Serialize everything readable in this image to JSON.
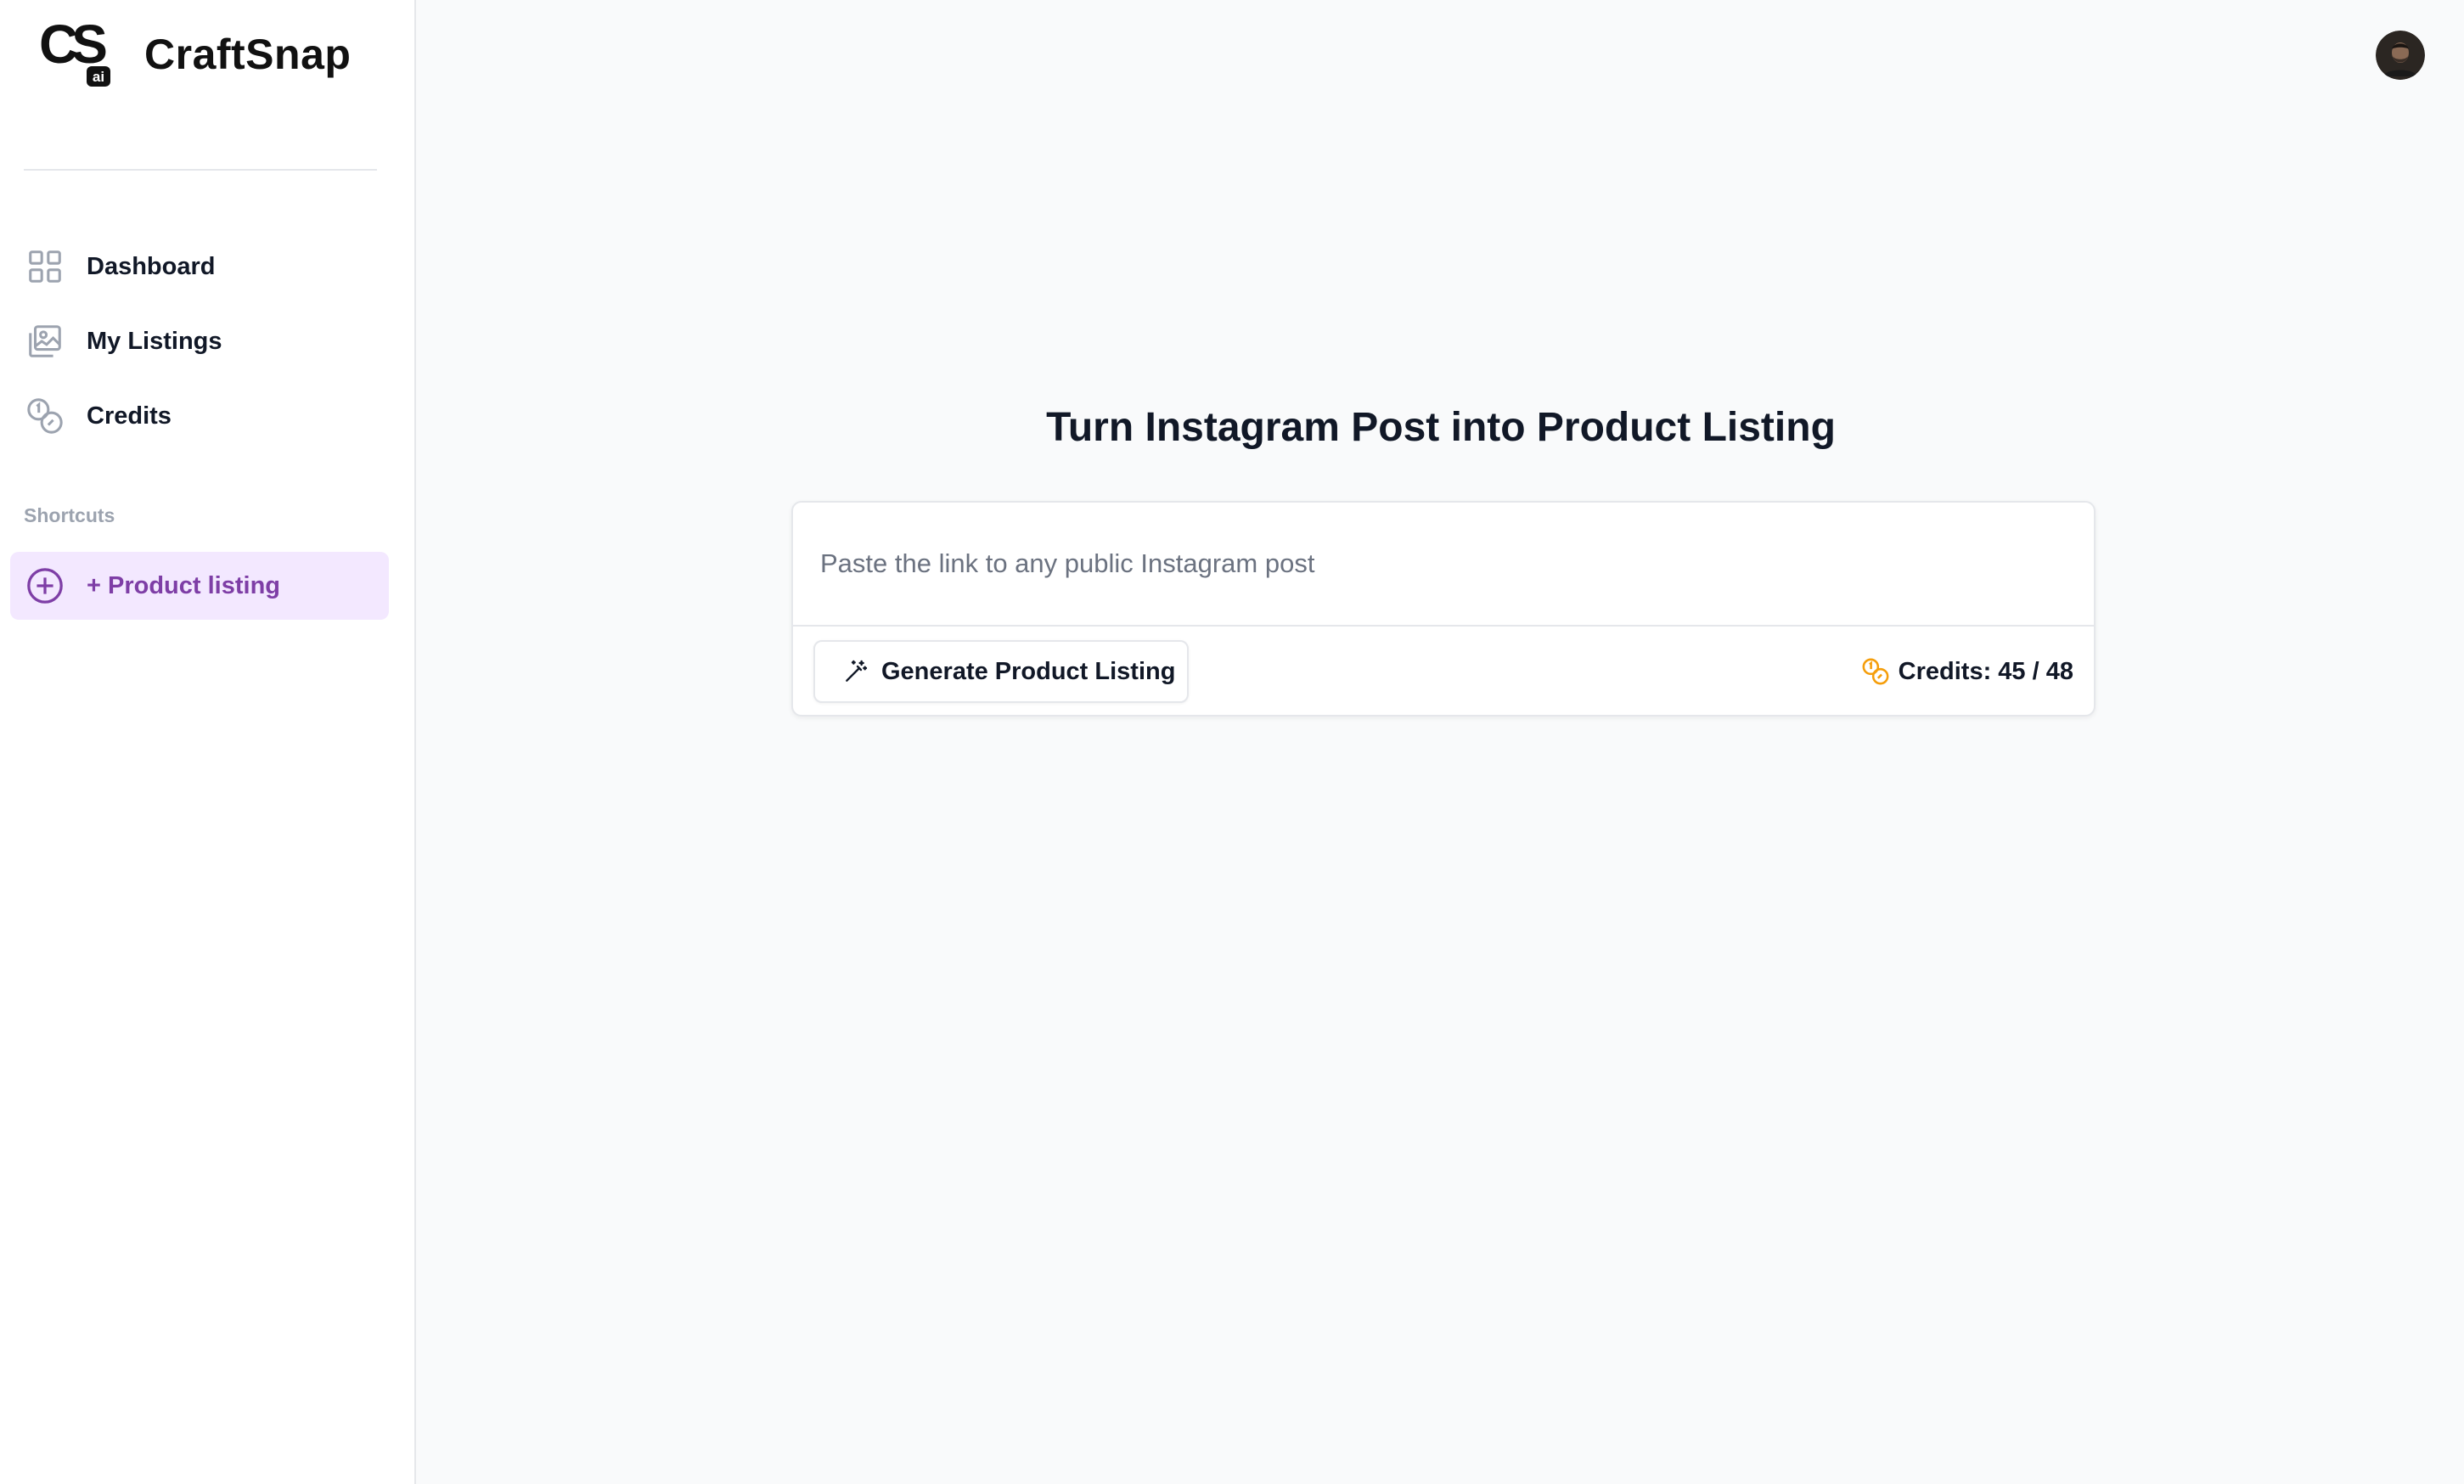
{
  "brand": {
    "logo_text": "CS",
    "logo_badge": "ai",
    "name": "CraftSnap"
  },
  "sidebar": {
    "nav": [
      {
        "label": "Dashboard",
        "icon": "grid-icon"
      },
      {
        "label": "My Listings",
        "icon": "images-icon"
      },
      {
        "label": "Credits",
        "icon": "coins-icon"
      }
    ],
    "shortcuts_label": "Shortcuts",
    "shortcut": {
      "label": "+ Product listing",
      "icon": "plus-circle-icon"
    }
  },
  "header": {
    "avatar": "user-avatar"
  },
  "main": {
    "title": "Turn Instagram Post into Product Listing",
    "input": {
      "value": "",
      "placeholder": "Paste the link to any public Instagram post"
    },
    "generate_button": "Generate Product Listing",
    "credits_text": "Credits: 45 / 48"
  },
  "colors": {
    "accent": "#7e3ea6",
    "shortcut_bg": "#f3e8ff",
    "credits_icon": "#f59e0b"
  }
}
